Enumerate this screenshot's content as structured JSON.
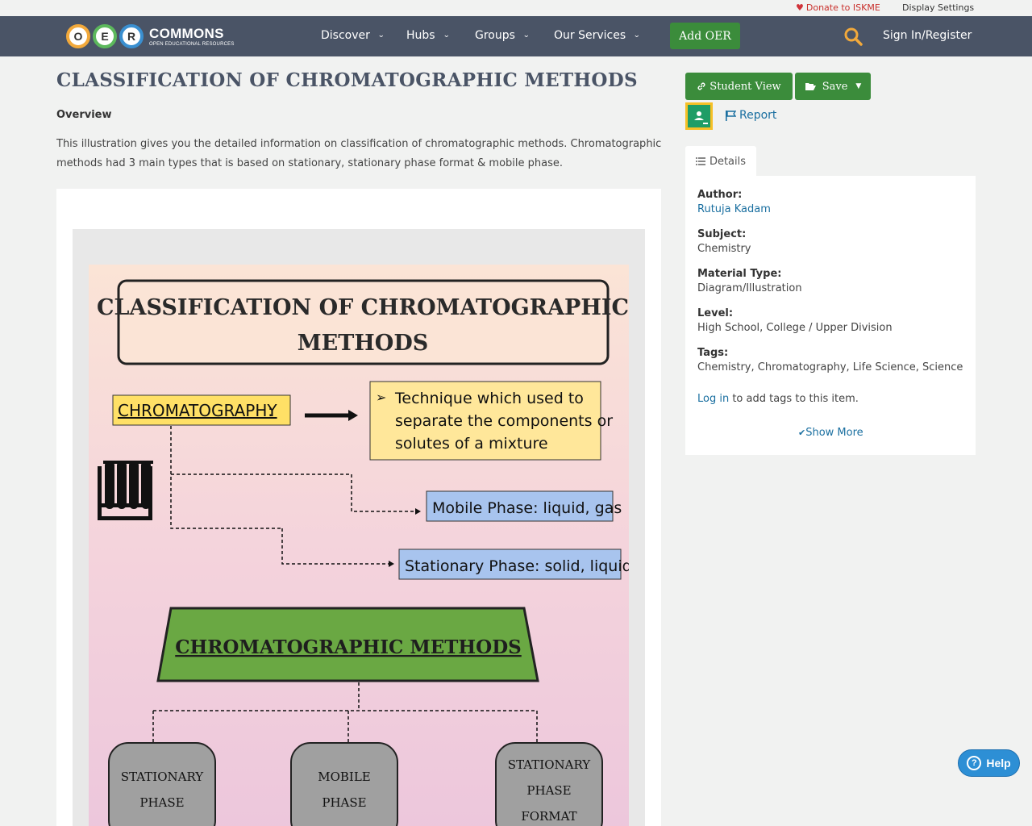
{
  "topbar": {
    "donate": "Donate to ISKME",
    "display_settings": "Display Settings"
  },
  "nav": {
    "logo_letters": [
      "O",
      "E",
      "R"
    ],
    "logo_brand": "COMMONS",
    "logo_tagline": "OPEN EDUCATIONAL RESOURCES",
    "items": [
      "Discover",
      "Hubs",
      "Groups",
      "Our Services"
    ],
    "add_oer": "Add OER",
    "sign_in": "Sign In/Register"
  },
  "page": {
    "title": "CLASSIFICATION OF CHROMATOGRAPHIC METHODS",
    "overview_heading": "Overview",
    "overview_text": "This illustration gives you the detailed information on classification of chromatographic methods. Chromatographic methods had 3 main types that is based on stationary, stationary phase format & mobile phase."
  },
  "poster": {
    "title_line1": "CLASSIFICATION OF CHROMATOGRAPHIC",
    "title_line2": "METHODS",
    "chromatography_label": "CHROMATOGRAPHY",
    "chromatography_colon": ":",
    "definition_line1": "Technique which used to",
    "definition_line2": "separate the components or",
    "definition_line3": "solutes of a mixture",
    "mobile_phase": "Mobile Phase: liquid, gas",
    "stationary_phase": "Stationary Phase: solid, liquid",
    "methods_banner": "CHROMATOGRAPHIC METHODS",
    "box1_line1": "STATIONARY",
    "box1_line2": "PHASE",
    "box2_line1": "MOBILE",
    "box2_line2": "PHASE",
    "box3_line1": "STATIONARY",
    "box3_line2": "PHASE",
    "box3_line3": "FORMAT"
  },
  "actions": {
    "student_view": "Student View",
    "save": "Save",
    "report": "Report"
  },
  "details": {
    "tab": "Details",
    "author_label": "Author:",
    "author": "Rutuja Kadam",
    "subject_label": "Subject:",
    "subject": "Chemistry",
    "material_label": "Material Type:",
    "material": "Diagram/Illustration",
    "level_label": "Level:",
    "level": "High School, College / Upper Division",
    "tags_label": "Tags:",
    "tags": "Chemistry, Chromatography, Life Science, Science",
    "login_link": "Log in",
    "login_rest": " to add tags to this item.",
    "show_more": "Show More"
  },
  "help": "Help",
  "colors": {
    "navbar": "#4a5466",
    "green_button": "#3b8c3b",
    "link": "#1a6fa0",
    "help": "#2d8fd5"
  }
}
